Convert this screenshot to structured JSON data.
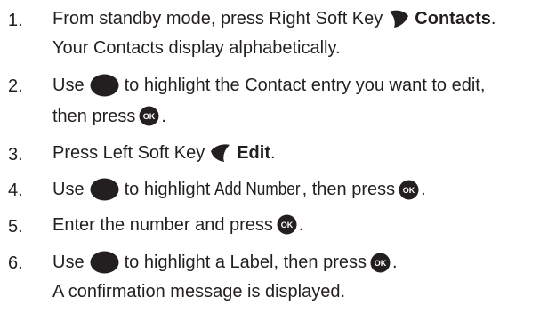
{
  "steps": [
    {
      "number": "1.",
      "line1_prefix": "From standby mode, press Right Soft Key",
      "line1_label": "Contacts",
      "line1_suffix": ".",
      "line2": "Your Contacts display alphabetically.",
      "icon": "right-soft-key-icon"
    },
    {
      "number": "2.",
      "line1_prefix": "Use",
      "line1_suffix": "to highlight the Contact entry you want to edit,",
      "line2_prefix": "then press",
      "line2_suffix": ".",
      "icons": [
        "navigation-key-icon",
        "ok-key-icon"
      ]
    },
    {
      "number": "3.",
      "prefix": "Press Left Soft Key",
      "label": "Edit",
      "suffix": ".",
      "icon": "left-soft-key-icon"
    },
    {
      "number": "4.",
      "prefix": "Use",
      "middle_a": "to highlight",
      "menu_item": "Add Number",
      "middle_b": ", then press",
      "suffix": ".",
      "icons": [
        "navigation-key-icon",
        "ok-key-icon"
      ]
    },
    {
      "number": "5.",
      "prefix": "Enter the number and press",
      "suffix": ".",
      "icon": "ok-key-icon"
    },
    {
      "number": "6.",
      "prefix": "Use",
      "middle": "to highlight a Label, then press",
      "suffix": ".",
      "line2": "A confirmation message is displayed.",
      "icons": [
        "navigation-key-icon",
        "ok-key-icon"
      ]
    }
  ],
  "ok_key_text": "OK",
  "colors": {
    "text": "#231f20",
    "icon": "#231f20",
    "icon_text": "#ffffff"
  }
}
